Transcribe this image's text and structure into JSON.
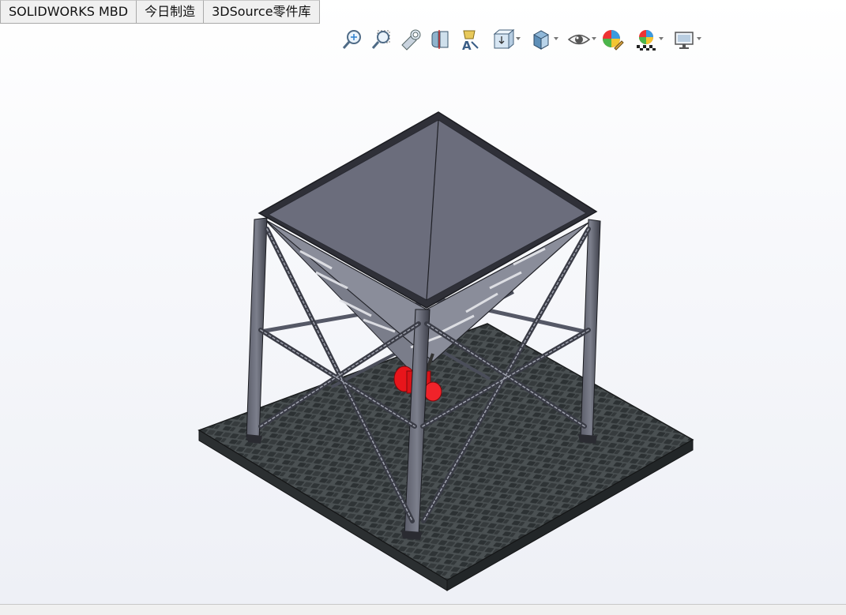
{
  "tabs": [
    {
      "label": "SOLIDWORKS MBD"
    },
    {
      "label": "今日制造"
    },
    {
      "label": "3DSource零件库"
    }
  ],
  "heads_up_toolbar": {
    "icons": [
      "zoom-to-fit-icon",
      "zoom-to-area-icon",
      "previous-view-icon",
      "section-view-icon",
      "dynamic-annotation-views-icon",
      "view-orientation-icon",
      "display-style-icon",
      "hide-show-items-icon",
      "edit-appearance-icon",
      "apply-scene-icon",
      "view-settings-icon"
    ]
  },
  "colors": {
    "steel_frame": "#4a4c58",
    "hopper_top": "#6b6d7c",
    "paving": "#3f4446",
    "motor": "#e8151b"
  }
}
